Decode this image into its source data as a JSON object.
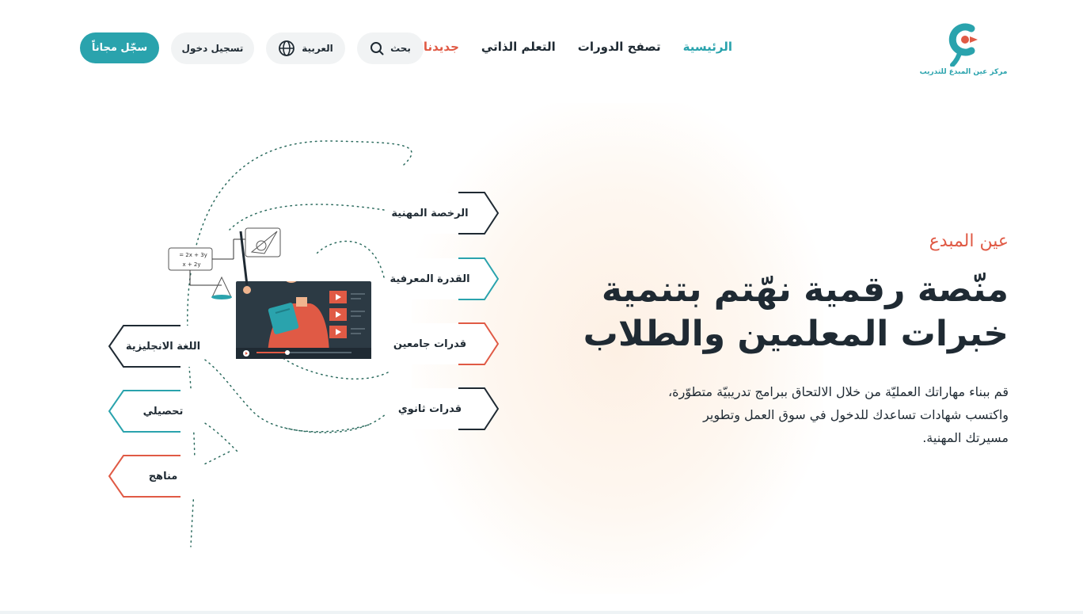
{
  "brand": {
    "logo_text": "مركز عين المبدع للتدريب",
    "colors": {
      "teal": "#2aa3ad",
      "coral": "#e05a45",
      "dark": "#1f2a33"
    }
  },
  "nav": {
    "items": [
      {
        "label": "الرئيسية",
        "active": true
      },
      {
        "label": "تصفح الدورات",
        "active": false
      },
      {
        "label": "التعلم الذاتي",
        "active": false
      }
    ],
    "new_label": "جديدنا"
  },
  "actions": {
    "search_label": "بحث",
    "search_icon": "search-icon",
    "language_label": "العربية",
    "language_icon": "globe-icon",
    "login_label": "تسجيل دخول",
    "register_label": "سجّل مجاناً"
  },
  "hero": {
    "eyebrow": "عين المبدع",
    "headline_line1": "منّصة رقمية نهّتم بتنمية",
    "headline_line2": "خبرات المعلمين والطلاب",
    "desc_line1": "قم ببناء مهاراتك العمليّة من خلال الالتحاق ببرامج تدريبيّة متطوّرة،",
    "desc_line2": "واكتسب شهادات تساعدك للدخول في سوق العمل وتطوير",
    "desc_line3": "مسيرتك المهنية."
  },
  "illustration": {
    "math_formula_top": "2x + 3y =",
    "math_formula_bottom": "x + 2y",
    "right_tags": [
      {
        "label": "الرخصة المهنية",
        "color": "#1f2a33"
      },
      {
        "label": "القدرة المعرفية",
        "color": "#2aa3ad"
      },
      {
        "label": "قدرات جامعين",
        "color": "#e05a45"
      },
      {
        "label": "قدرات ثانوي",
        "color": "#1f2a33"
      }
    ],
    "left_tags": [
      {
        "label": "اللغة الانجليزية",
        "color": "#1f2a33"
      },
      {
        "label": "تحصيلي",
        "color": "#2aa3ad"
      },
      {
        "label": "مناهج",
        "color": "#e05a45"
      }
    ]
  }
}
